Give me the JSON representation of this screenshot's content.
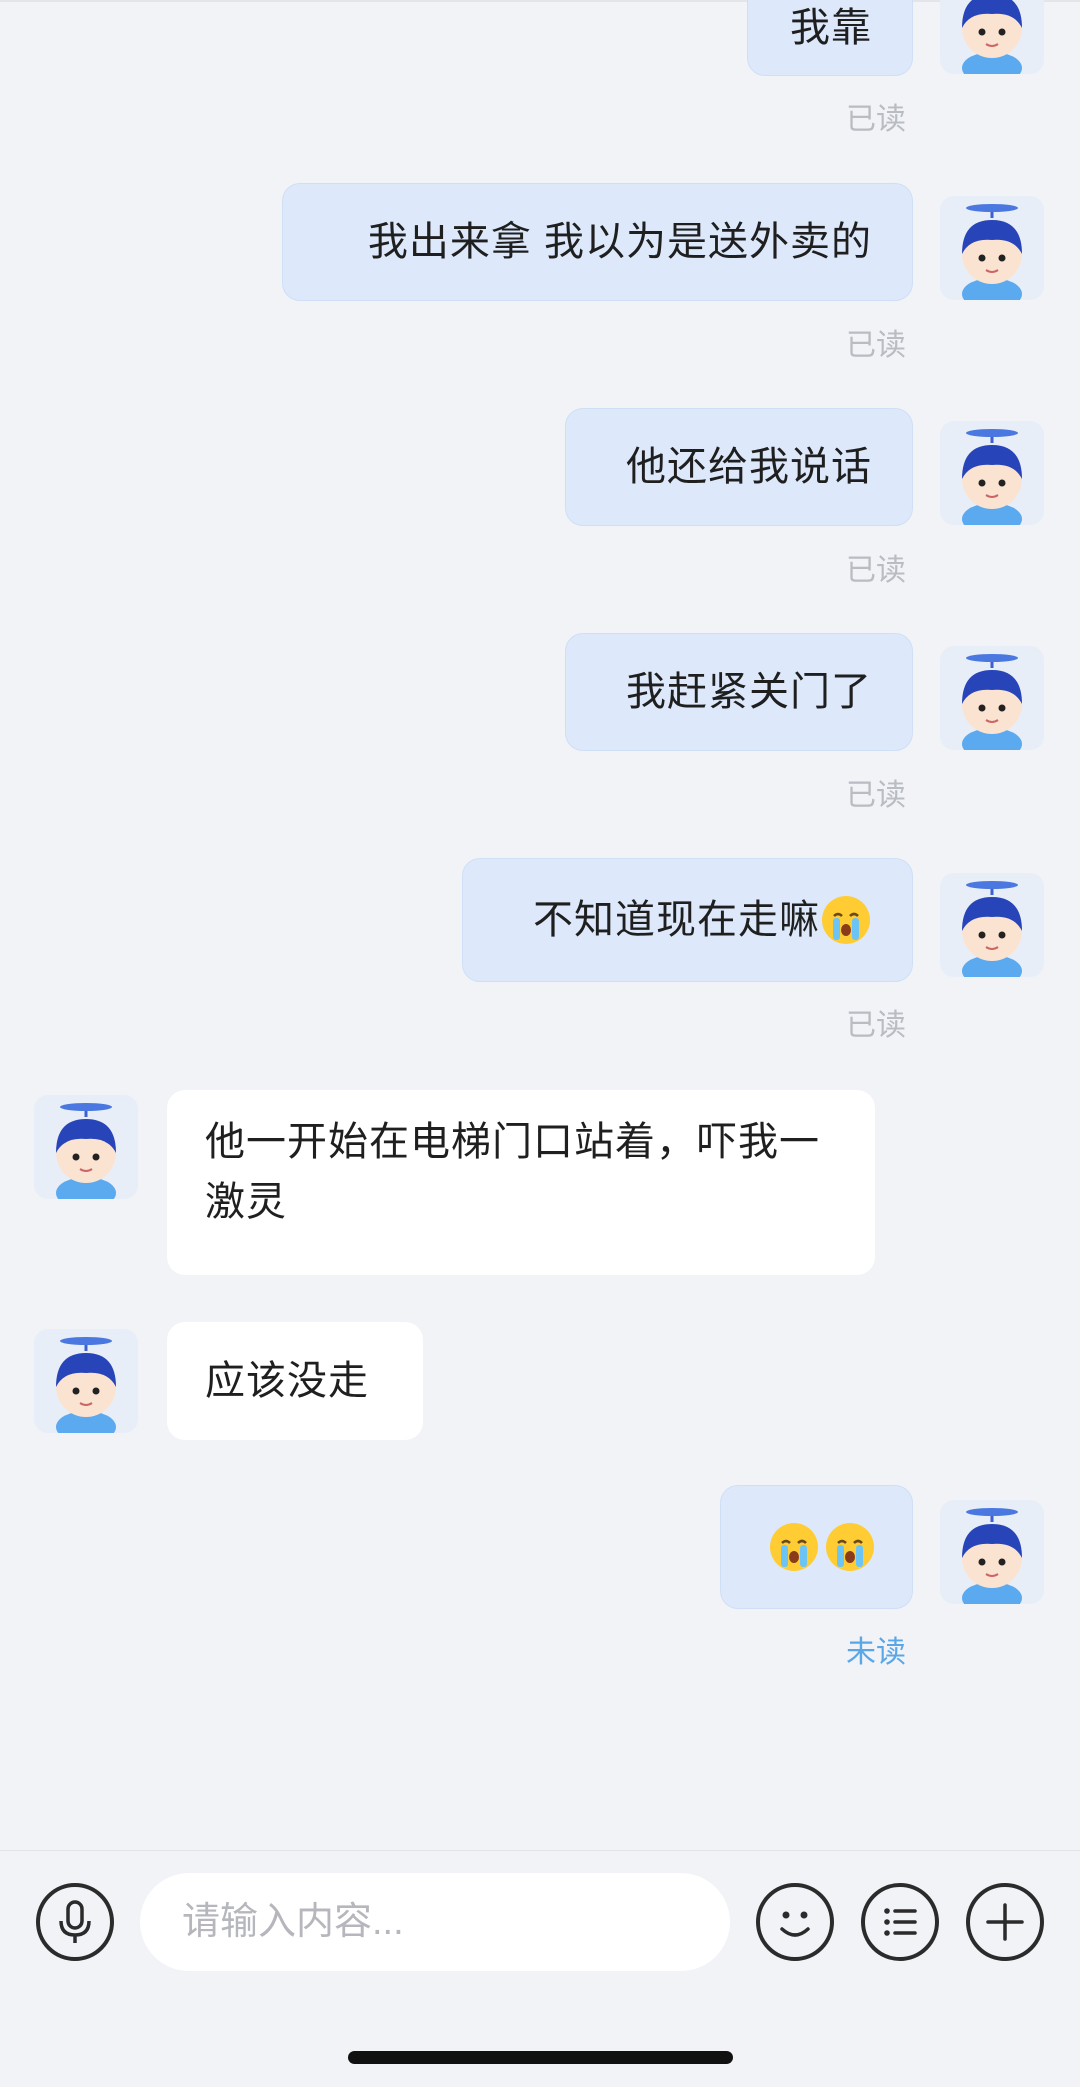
{
  "conversation": {
    "messages": [
      {
        "direction": "out",
        "text": "我靠",
        "status": "已读"
      },
      {
        "direction": "out",
        "text": "我出来拿 我以为是送外卖的",
        "status": "已读"
      },
      {
        "direction": "out",
        "text": "他还给我说话",
        "status": "已读"
      },
      {
        "direction": "out",
        "text": "我赶紧关门了",
        "status": "已读"
      },
      {
        "direction": "out",
        "text": "不知道现在走嘛",
        "emoji": "crying-face",
        "status": "已读"
      },
      {
        "direction": "in",
        "text": "他一开始在电梯门口站着，吓我一激灵"
      },
      {
        "direction": "in",
        "text": "应该没走"
      },
      {
        "direction": "out",
        "text": "",
        "emoji": [
          "crying-face",
          "crying-face"
        ],
        "status": "未读"
      }
    ]
  },
  "input_bar": {
    "placeholder": "请输入内容...",
    "icons": [
      "microphone-icon",
      "smiley-icon",
      "list-menu-icon",
      "plus-icon"
    ]
  },
  "colors": {
    "background": "#f1f3f7",
    "outgoing_bubble": "#dde9fb",
    "incoming_bubble": "#ffffff",
    "read_status": "#b9bcc2",
    "unread_status": "#5aa7e8"
  }
}
